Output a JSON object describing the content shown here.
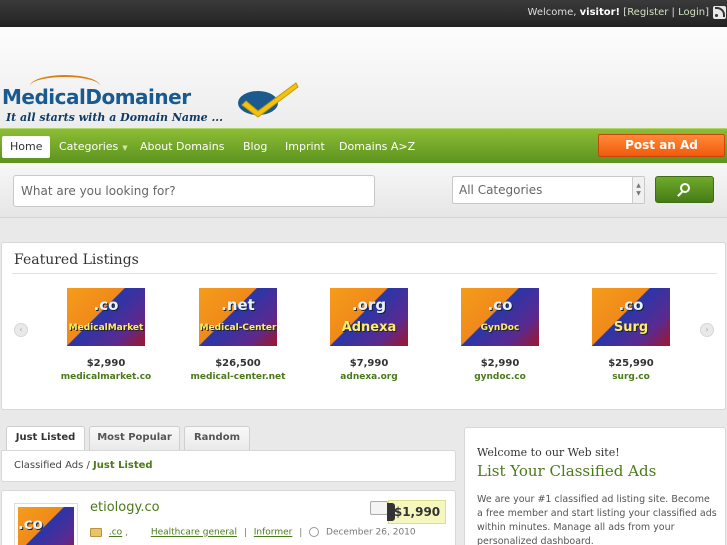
{
  "topbar": {
    "welcome_prefix": "Welcome,",
    "user": "visitor!",
    "open_bracket": "[",
    "register": "Register",
    "separator": "|",
    "login": "Login",
    "close_bracket": "]"
  },
  "brand": {
    "name_part1": "Medical",
    "name_part2": "Domainer",
    "tagline": "It all starts with a Domain Name ..."
  },
  "nav": {
    "items": [
      "Home",
      "Categories",
      "About Domains",
      "Blog",
      "Imprint",
      "Domains A>Z"
    ],
    "caret": "▼",
    "post_ad": "Post an Ad"
  },
  "search": {
    "placeholder": "What are you looking for?",
    "category_selected": "All Categories"
  },
  "featured": {
    "title": "Featured Listings",
    "prev": "‹",
    "next": "›",
    "items": [
      {
        "tld": ".co",
        "thumb_name": "MedicalMarket",
        "price": "$2,990",
        "domain": "medicalmarket.co"
      },
      {
        "tld": ".net",
        "thumb_name": "Medical-Center",
        "price": "$26,500",
        "domain": "medical-center.net"
      },
      {
        "tld": ".org",
        "thumb_name": "Adnexa",
        "price": "$7,990",
        "domain": "adnexa.org"
      },
      {
        "tld": ".co",
        "thumb_name": "GynDoc",
        "price": "$2,990",
        "domain": "gyndoc.co"
      },
      {
        "tld": ".co",
        "thumb_name": "Surg",
        "price": "$25,990",
        "domain": "surg.co"
      }
    ]
  },
  "tabs": [
    "Just Listed",
    "Most Popular",
    "Random"
  ],
  "breadcrumb": {
    "root": "Classified Ads",
    "sep": "/",
    "current": "Just Listed"
  },
  "listing": {
    "title": "etiology.co",
    "price": "$1,990",
    "thumb_tld": ".co",
    "tld": ".co",
    "dot": ",",
    "category": "Healthcare general",
    "sep": "|",
    "author": "Informer",
    "date": "December 26, 2010"
  },
  "widget": {
    "welcome": "Welcome to our Web site!",
    "headline": "List Your Classified Ads",
    "text": "We are your #1 classified ad listing site. Become a free member and start listing your classified ads within minutes. Manage all ads from your personalized dashboard."
  },
  "colors": {
    "accent_green": "#5d931f",
    "post_orange": "#f15a0a",
    "link_green": "#4a7a1a",
    "topbar": "#2a2a2a"
  },
  "icons": [
    "rss-icon",
    "search-icon",
    "folder-icon",
    "clock-icon",
    "price-tag-icon",
    "chevron-left-icon",
    "chevron-right-icon"
  ]
}
